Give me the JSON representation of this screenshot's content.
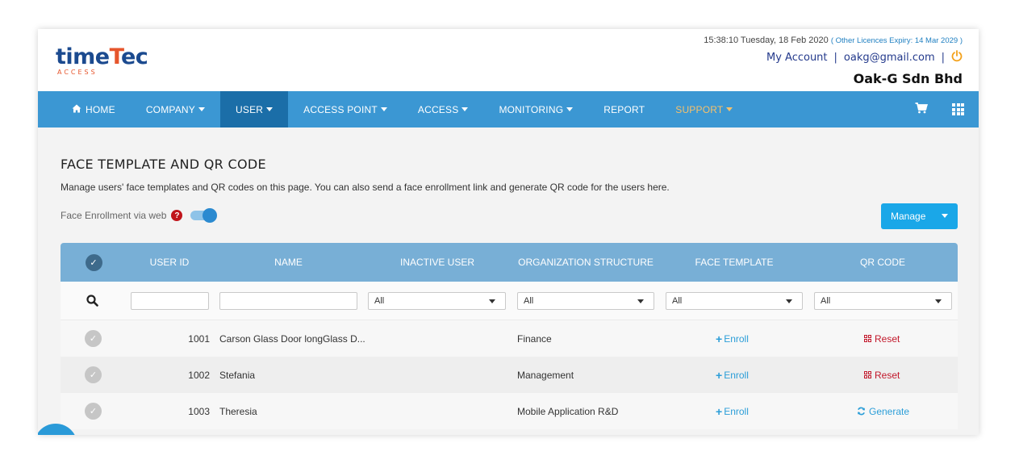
{
  "header": {
    "logo_main": "time",
    "logo_tec_t": "T",
    "logo_tec_rest": "ec",
    "logo_sub": "ACCESS",
    "datetime": "15:38:10 Tuesday, 18 Feb 2020",
    "licence": "( Other Licences Expiry:  14 Mar 2029 )",
    "my_account": "My Account",
    "sep": "|",
    "email": "oakg@gmail.com",
    "company": "Oak-G Sdn Bhd",
    "power_icon": "power-icon"
  },
  "nav": {
    "home": "HOME",
    "company": "COMPANY",
    "user": "USER",
    "access_point": "ACCESS POINT",
    "access": "ACCESS",
    "monitoring": "MONITORING",
    "report": "REPORT",
    "support": "SUPPORT",
    "cart_icon": "cart-icon",
    "apps_icon": "apps-grid-icon"
  },
  "page": {
    "title": "FACE TEMPLATE AND QR CODE",
    "description": "Manage users' face templates and QR codes on this page. You can also send a face enrollment link and generate QR code for the users here.",
    "face_enrollment_label": "Face Enrollment via web",
    "help": "?",
    "face_enrollment_enabled": true,
    "manage": "Manage"
  },
  "table": {
    "columns": [
      "USER ID",
      "NAME",
      "INACTIVE USER",
      "ORGANIZATION STRUCTURE",
      "FACE TEMPLATE",
      "QR CODE"
    ],
    "filters": {
      "inactive_user": "All",
      "organization": "All",
      "face_template": "All",
      "qr_code": "All"
    },
    "rows": [
      {
        "id": "1001",
        "name": "Carson Glass Door longGlass D...",
        "org": "Finance",
        "face": "Enroll",
        "qr": "Reset",
        "qr_type": "reset"
      },
      {
        "id": "1002",
        "name": "Stefania",
        "org": "Management",
        "face": "Enroll",
        "qr": "Reset",
        "qr_type": "reset"
      },
      {
        "id": "1003",
        "name": "Theresia",
        "org": "Mobile Application R&D",
        "face": "Enroll",
        "qr": "Generate",
        "qr_type": "generate"
      }
    ]
  },
  "colors": {
    "nav_bg": "#3b97d3",
    "nav_active": "#1b6ea8",
    "table_header": "#78afd6",
    "accent_blue": "#1aa7e8",
    "reset_red": "#c2182b"
  }
}
